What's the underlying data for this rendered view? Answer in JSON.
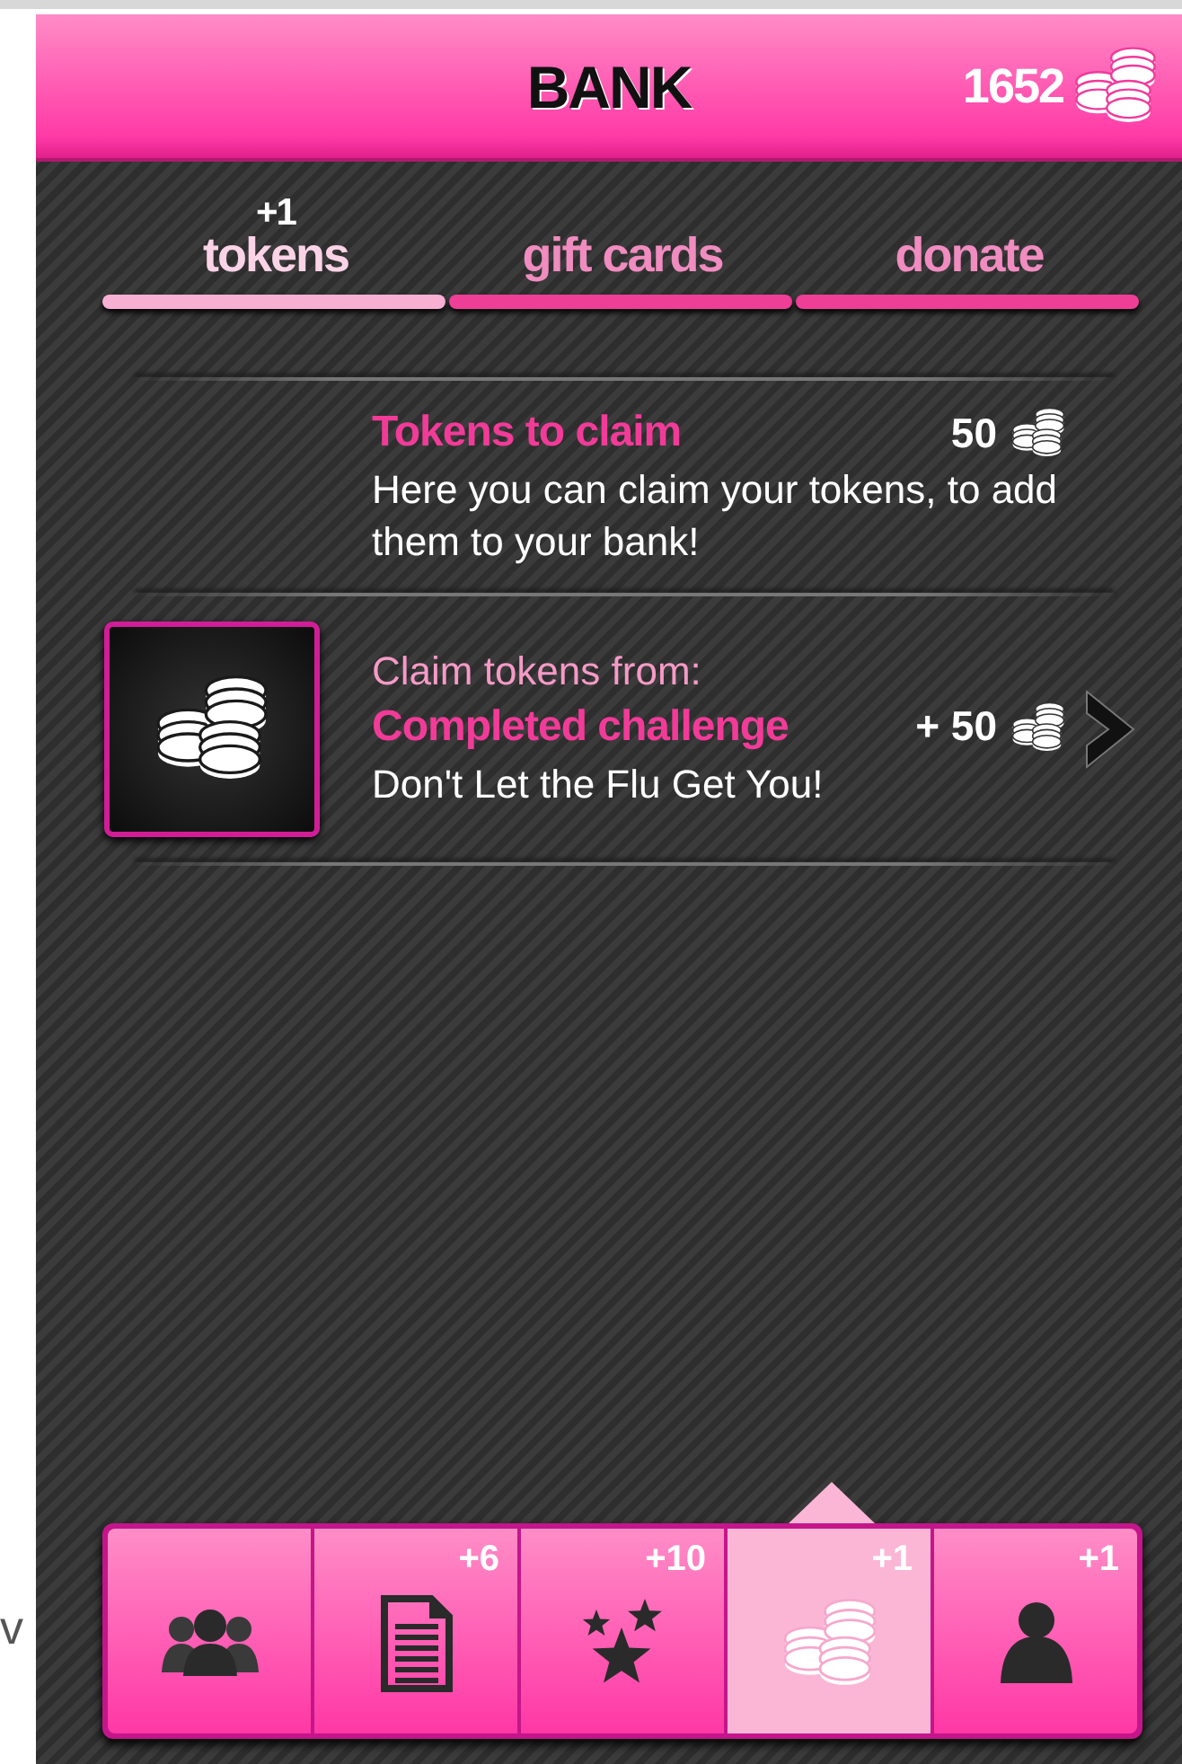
{
  "margin_text": "v",
  "header": {
    "title": "BANK",
    "balance": "1652"
  },
  "tabs": [
    {
      "label": "tokens",
      "badge": "+1",
      "selected": true
    },
    {
      "label": "gift cards",
      "selected": false
    },
    {
      "label": "donate",
      "selected": false
    }
  ],
  "claims": [
    {
      "kind": "summary",
      "title": "Tokens to claim",
      "amount": "50",
      "description": "Here you can claim your tokens, to add them to your bank!"
    },
    {
      "kind": "challenge",
      "caption": "Claim tokens from:",
      "title": "Completed challenge",
      "amount": "+ 50",
      "description": "Don't Let the Flu Get You!"
    }
  ],
  "nav": [
    {
      "kind": "group",
      "selected": false
    },
    {
      "kind": "document",
      "badge": "+6",
      "selected": false
    },
    {
      "kind": "stars",
      "badge": "+10",
      "selected": false
    },
    {
      "kind": "coins",
      "badge": "+1",
      "selected": true
    },
    {
      "kind": "person",
      "badge": "+1",
      "selected": false
    }
  ]
}
